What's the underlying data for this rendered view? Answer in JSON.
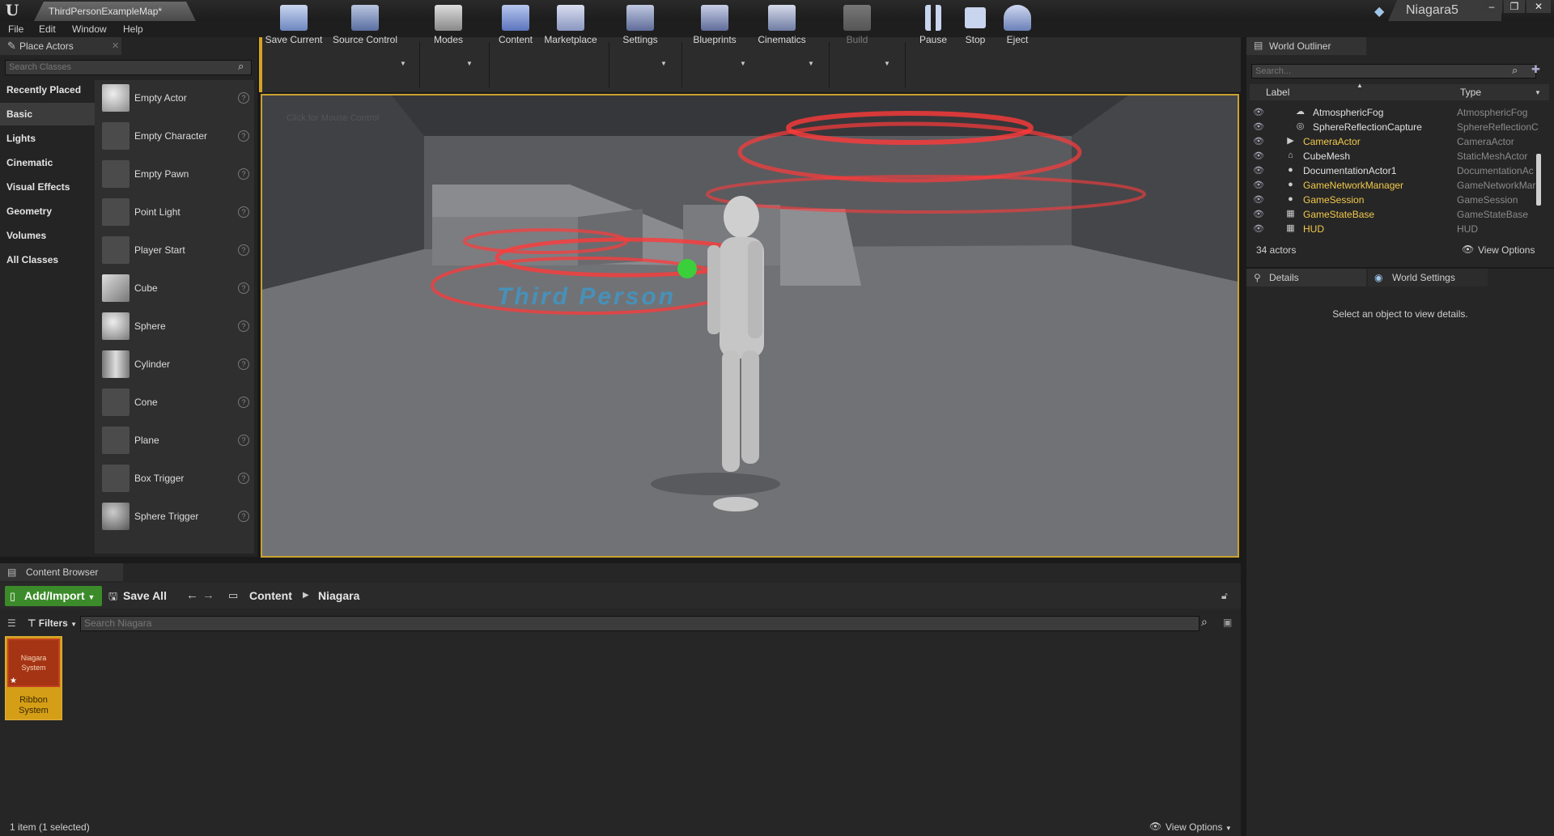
{
  "window": {
    "tab_title": "ThirdPersonExampleMap*",
    "project_name": "Niagara5"
  },
  "menu": [
    "File",
    "Edit",
    "Window",
    "Help"
  ],
  "place_actors": {
    "tab_label": "Place Actors",
    "search_placeholder": "Search Classes",
    "categories": [
      "Recently Placed",
      "Basic",
      "Lights",
      "Cinematic",
      "Visual Effects",
      "Geometry",
      "Volumes",
      "All Classes"
    ],
    "selected_category": "Basic",
    "actors": [
      "Empty Actor",
      "Empty Character",
      "Empty Pawn",
      "Point Light",
      "Player Start",
      "Cube",
      "Sphere",
      "Cylinder",
      "Cone",
      "Plane",
      "Box Trigger",
      "Sphere Trigger"
    ]
  },
  "toolbar": {
    "items": [
      "Save Current",
      "Source Control",
      "Modes",
      "Content",
      "Marketplace",
      "Settings",
      "Blueprints",
      "Cinematics",
      "Build",
      "Pause",
      "Stop",
      "Eject"
    ]
  },
  "viewport": {
    "hint": "Click for Mouse Control",
    "floor_text": "Third Person"
  },
  "outliner": {
    "tab_label": "World Outliner",
    "search_placeholder": "Search...",
    "col_label": "Label",
    "col_type": "Type",
    "rows": [
      {
        "label": "AtmosphericFog",
        "type": "AtmosphericFog",
        "indent": true,
        "bp": false
      },
      {
        "label": "SphereReflectionCapture",
        "type": "SphereReflectionC",
        "indent": true,
        "bp": false
      },
      {
        "label": "CameraActor",
        "type": "CameraActor",
        "indent": false,
        "bp": true
      },
      {
        "label": "CubeMesh",
        "type": "StaticMeshActor",
        "indent": false,
        "bp": false
      },
      {
        "label": "DocumentationActor1",
        "type": "DocumentationAc",
        "indent": false,
        "bp": false
      },
      {
        "label": "GameNetworkManager",
        "type": "GameNetworkMar",
        "indent": false,
        "bp": true
      },
      {
        "label": "GameSession",
        "type": "GameSession",
        "indent": false,
        "bp": true
      },
      {
        "label": "GameStateBase",
        "type": "GameStateBase",
        "indent": false,
        "bp": true
      },
      {
        "label": "HUD",
        "type": "HUD",
        "indent": false,
        "bp": true
      }
    ],
    "actor_count": "34 actors",
    "view_options": "View Options"
  },
  "details": {
    "tab_details": "Details",
    "tab_world_settings": "World Settings",
    "empty_message": "Select an object to view details."
  },
  "content_browser": {
    "tab_label": "Content Browser",
    "add_import": "Add/Import",
    "save_all": "Save All",
    "path": [
      "Content",
      "Niagara"
    ],
    "filters": "Filters",
    "search_placeholder": "Search Niagara",
    "asset": {
      "type": "Niagara System",
      "name": "Ribbon System"
    },
    "status": "1 item (1 selected)",
    "view_options": "View Options"
  },
  "colors": {
    "accent": "#d6a422",
    "add_green": "#3c8b2a",
    "blueprint_label": "#f2c94c",
    "ring_red": "#ff3a3a"
  }
}
